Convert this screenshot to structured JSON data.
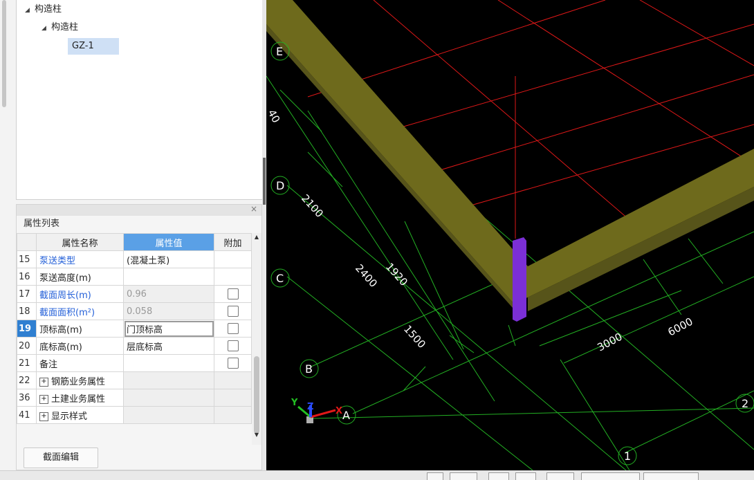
{
  "tree": {
    "root_label": "构造柱",
    "child_label": "构造柱",
    "leaf_label": "GZ-1"
  },
  "property_panel": {
    "title": "属性列表",
    "close_label": "×",
    "headers": {
      "name": "属性名称",
      "value": "属性值",
      "extra": "附加"
    },
    "rows": [
      {
        "num": "15",
        "name": "泵送类型",
        "value": "(混凝土泵)",
        "name_blue": true
      },
      {
        "num": "16",
        "name": "泵送高度(m)",
        "value": ""
      },
      {
        "num": "17",
        "name": "截面周长(m)",
        "value": "0.96",
        "name_blue": true,
        "readonly": true,
        "checkbox": true
      },
      {
        "num": "18",
        "name": "截面面积(m²)",
        "value": "0.058",
        "name_blue": true,
        "readonly": true,
        "checkbox": true
      },
      {
        "num": "19",
        "name": "顶标高(m)",
        "value": "门顶标高",
        "selected": true,
        "checkbox": true
      },
      {
        "num": "20",
        "name": "底标高(m)",
        "value": "层底标高",
        "checkbox": true
      },
      {
        "num": "21",
        "name": "备注",
        "value": "",
        "checkbox": true
      },
      {
        "num": "22",
        "name": "钢筋业务属性",
        "value": "",
        "group": true
      },
      {
        "num": "36",
        "name": "土建业务属性",
        "value": "",
        "group": true
      },
      {
        "num": "41",
        "name": "显示样式",
        "value": "",
        "group": true
      }
    ],
    "section_button": "截面编辑"
  },
  "viewport": {
    "axis_labels": {
      "E": "E",
      "D": "D",
      "C": "C",
      "B": "B",
      "A": "A",
      "n1": "1",
      "n2": "2"
    },
    "dimensions": {
      "d40": "40",
      "d2100": "2100",
      "d1920": "1920",
      "d2400": "2400",
      "d1500": "1500",
      "d3000": "3000",
      "d6000": "6000"
    },
    "triad": {
      "x": "X",
      "y": "Y",
      "z": "Z"
    }
  },
  "colors": {
    "beam": "#6e6a1c",
    "beam_shade": "#57541a",
    "column": "#7b2fd6",
    "grid_red": "#e01818",
    "grid_green": "#23b023",
    "select_blue": "#2f7fd1",
    "header_blue": "#5aa0e6",
    "link_blue": "#2460d8"
  }
}
